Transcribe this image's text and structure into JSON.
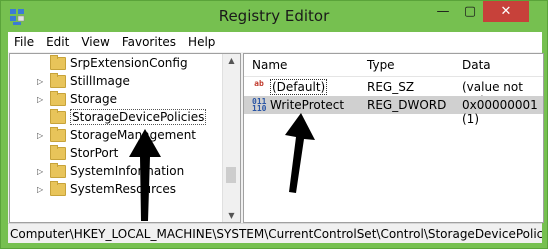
{
  "window": {
    "title": "Registry Editor",
    "minimize": "—",
    "maximize": "▢",
    "close": "✕"
  },
  "menu": [
    "File",
    "Edit",
    "View",
    "Favorites",
    "Help"
  ],
  "tree": {
    "items": [
      {
        "label": "SrpExtensionConfig",
        "expandable": false
      },
      {
        "label": "StillImage",
        "expandable": true
      },
      {
        "label": "Storage",
        "expandable": true
      },
      {
        "label": "StorageDevicePolicies",
        "expandable": false,
        "selected": true
      },
      {
        "label": "StorageManagement",
        "expandable": true
      },
      {
        "label": "StorPort",
        "expandable": false
      },
      {
        "label": "SystemInformation",
        "expandable": true
      },
      {
        "label": "SystemResources",
        "expandable": true
      }
    ]
  },
  "list": {
    "headers": {
      "name": "Name",
      "type": "Type",
      "data": "Data"
    },
    "rows": [
      {
        "icon": "string-value-icon",
        "icon_text": "ab",
        "name": "(Default)",
        "type": "REG_SZ",
        "data": "(value not set)",
        "selected": false
      },
      {
        "icon": "dword-value-icon",
        "icon_text": "011\n110",
        "name": "WriteProtect",
        "type": "REG_DWORD",
        "data": "0x00000001 (1)",
        "selected": true
      }
    ]
  },
  "status": {
    "path": "Computer\\HKEY_LOCAL_MACHINE\\SYSTEM\\CurrentControlSet\\Control\\StorageDevicePolicies"
  },
  "colors": {
    "frame": "#76c050",
    "close": "#c7413a",
    "selection": "#d0d0d0"
  }
}
